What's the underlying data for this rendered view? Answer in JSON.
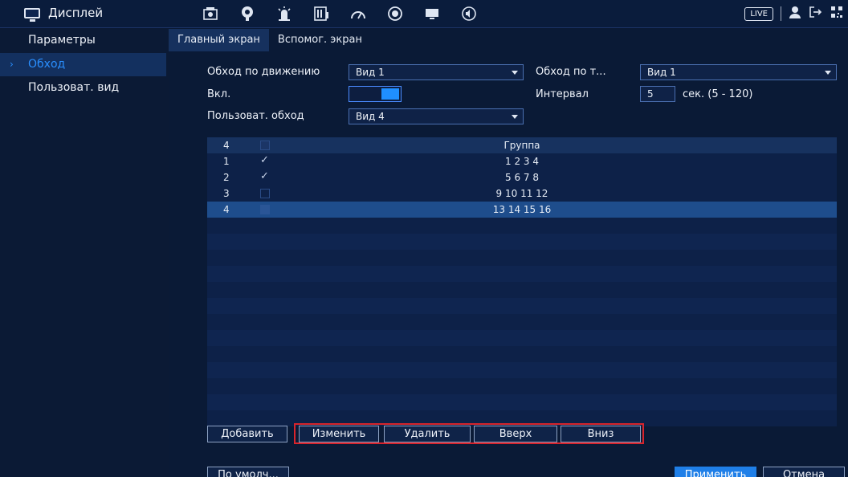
{
  "header": {
    "title": "Дисплей",
    "icons": [
      "camera-icon",
      "network-icon",
      "alarm-icon",
      "storage-icon",
      "system-icon",
      "settings-icon",
      "display-icon",
      "audio-icon"
    ],
    "live_label": "LIVE",
    "right_icons": [
      "user-icon",
      "logout-icon",
      "qr-icon"
    ]
  },
  "sidebar": {
    "items": [
      {
        "label": "Параметры"
      },
      {
        "label": "Обход"
      },
      {
        "label": "Пользоват. вид"
      }
    ]
  },
  "tabs": [
    {
      "label": "Главный экран"
    },
    {
      "label": "Вспомог. экран"
    }
  ],
  "form": {
    "motion_tour_label": "Обход по движению",
    "motion_tour_value": "Вид 1",
    "alarm_tour_label": "Обход по т...",
    "alarm_tour_value": "Вид 1",
    "enable_label": "Вкл.",
    "enabled": true,
    "interval_label": "Интервал",
    "interval_value": "5",
    "interval_unit": "сек. (5 - 120)",
    "custom_tour_label": "Пользоват. обход",
    "custom_tour_value": "Вид 4"
  },
  "table": {
    "header_num": "4",
    "header_group": "Группа",
    "rows": [
      {
        "num": "1",
        "checked": true,
        "group": "1 2 3 4"
      },
      {
        "num": "2",
        "checked": true,
        "group": "5 6 7 8"
      },
      {
        "num": "3",
        "checked": false,
        "group": "9 10 11 12"
      },
      {
        "num": "4",
        "checked": false,
        "group": "13 14 15 16",
        "selected": true
      }
    ]
  },
  "buttons": {
    "add": "Добавить",
    "modify": "Изменить",
    "delete": "Удалить",
    "up": "Вверх",
    "down": "Вниз",
    "default": "По умолч...",
    "apply": "Применить",
    "cancel": "Отмена"
  },
  "colors": {
    "accent": "#1f8fff",
    "highlight_box": "#d8242c",
    "selected_row": "#1e4d8c"
  }
}
